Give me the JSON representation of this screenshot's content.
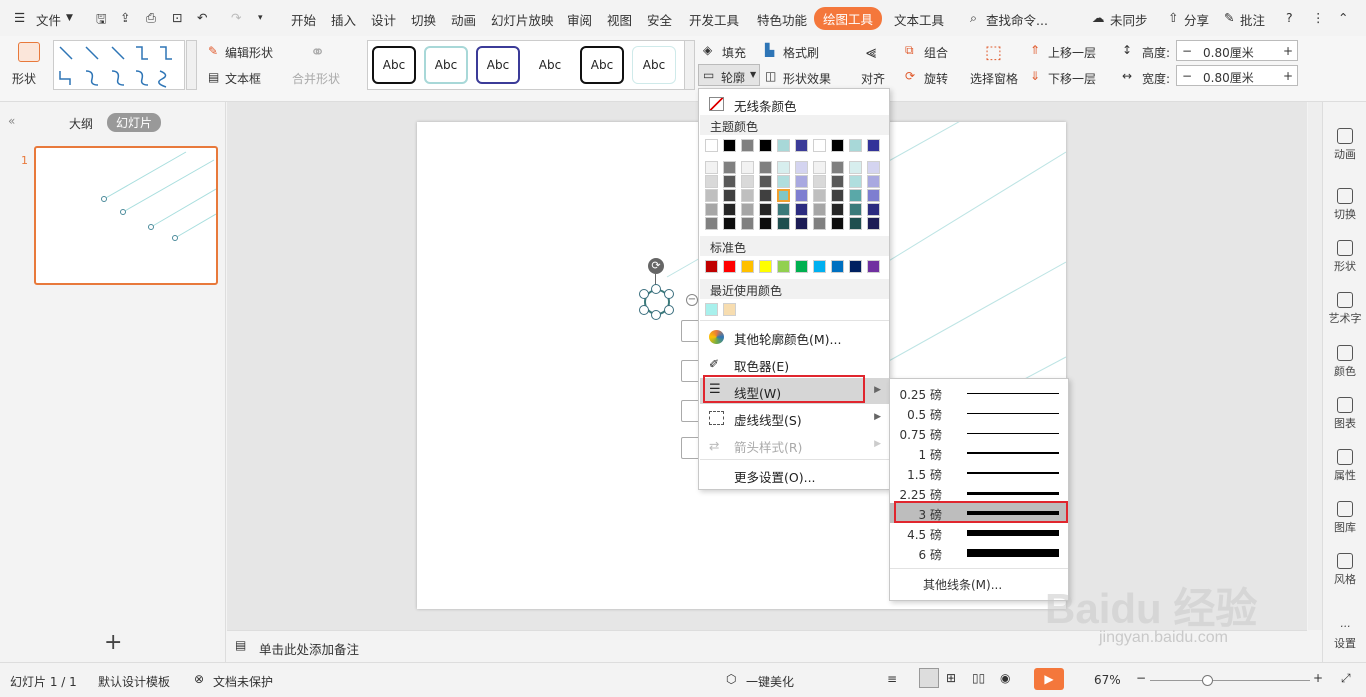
{
  "topbar": {
    "menu": "文件",
    "tabs": [
      "开始",
      "插入",
      "设计",
      "切换",
      "动画",
      "幻灯片放映",
      "审阅",
      "视图",
      "安全",
      "开发工具",
      "特色功能",
      "绘图工具",
      "文本工具"
    ],
    "active_tab": "绘图工具",
    "search": "查找命令...",
    "sync": "未同步",
    "share": "分享",
    "comment": "批注",
    "help": "?"
  },
  "ribbon": {
    "shape": "形状",
    "edit_shape": "编辑形状",
    "textbox": "文本框",
    "merge_shape": "合并形状",
    "style_label": "Abc",
    "fill": "填充",
    "format_brush": "格式刷",
    "outline": "轮廓",
    "shape_effect": "形状效果",
    "align": "对齐",
    "group": "组合",
    "rotate": "旋转",
    "select_pane": "选择窗格",
    "bring_forward": "上移一层",
    "send_backward": "下移一层",
    "height_label": "高度:",
    "height_value": "0.80厘米",
    "width_label": "宽度:",
    "width_value": "0.80厘米"
  },
  "leftpanel": {
    "outline_tab": "大纲",
    "slides_tab": "幻灯片",
    "slide_number": "1",
    "add": "+"
  },
  "notes": {
    "placeholder": "单击此处添加备注"
  },
  "dropdown": {
    "no_line": "无线条颜色",
    "theme_colors": "主题颜色",
    "standard_colors": "标准色",
    "recent_colors": "最近使用颜色",
    "more_colors": "其他轮廓颜色(M)...",
    "eyedropper": "取色器(E)",
    "line_style": "线型(W)",
    "dash_style": "虚线线型(S)",
    "arrow_style": "箭头样式(R)",
    "more_settings": "更多设置(O)...",
    "theme_top": [
      "#ffffff",
      "#000000",
      "#808080",
      "#000000",
      "#a8d8d8",
      "#3b3b98",
      "#ffffff",
      "#000000",
      "#a8d8d8",
      "#333399"
    ],
    "theme_grid": [
      [
        "#f2f2f2",
        "#808080",
        "#f2f2f2",
        "#7f7f7f",
        "#d7eeee",
        "#d4d4f0",
        "#f2f2f2",
        "#7f7f7f",
        "#d7eeee",
        "#d4d4f0"
      ],
      [
        "#d9d9d9",
        "#595959",
        "#d9d9d9",
        "#595959",
        "#b0dede",
        "#a9a9e0",
        "#d9d9d9",
        "#595959",
        "#b0dede",
        "#a9a9e0"
      ],
      [
        "#bfbfbf",
        "#404040",
        "#bfbfbf",
        "#404040",
        "#7fc6c6",
        "#7e7ed0",
        "#bfbfbf",
        "#404040",
        "#5aa8a8",
        "#7e7ed0"
      ],
      [
        "#a6a6a6",
        "#262626",
        "#a6a6a6",
        "#262626",
        "#3b7a7a",
        "#2c2c80",
        "#a6a6a6",
        "#262626",
        "#3b7a7a",
        "#2c2c80"
      ],
      [
        "#808080",
        "#0d0d0d",
        "#808080",
        "#0d0d0d",
        "#1f4f4f",
        "#1c1c55",
        "#808080",
        "#0d0d0d",
        "#1f4f4f",
        "#1c1c55"
      ]
    ],
    "standard": [
      "#c00000",
      "#ff0000",
      "#ffc000",
      "#ffff00",
      "#92d050",
      "#00b050",
      "#00b0f0",
      "#0070c0",
      "#002060",
      "#7030a0"
    ],
    "recent": [
      "#a8f0ec",
      "#f7ddb0"
    ]
  },
  "submenu": {
    "weights": [
      "0.25 磅",
      "0.5 磅",
      "0.75 磅",
      "1 磅",
      "1.5 磅",
      "2.25 磅",
      "3 磅",
      "4.5 磅",
      "6 磅"
    ],
    "selected": "3 磅",
    "more": "其他线条(M)..."
  },
  "rightbar": [
    "动画",
    "切换",
    "形状",
    "艺术字",
    "颜色",
    "图表",
    "属性",
    "图库",
    "风格",
    "设置"
  ],
  "statusbar": {
    "slide_count": "幻灯片 1 / 1",
    "template": "默认设计模板",
    "protect": "文档未保护",
    "beautify": "一键美化",
    "zoom": "67%"
  },
  "watermark": {
    "brand": "Baidu 经验",
    "url": "jingyan.baidu.com"
  }
}
